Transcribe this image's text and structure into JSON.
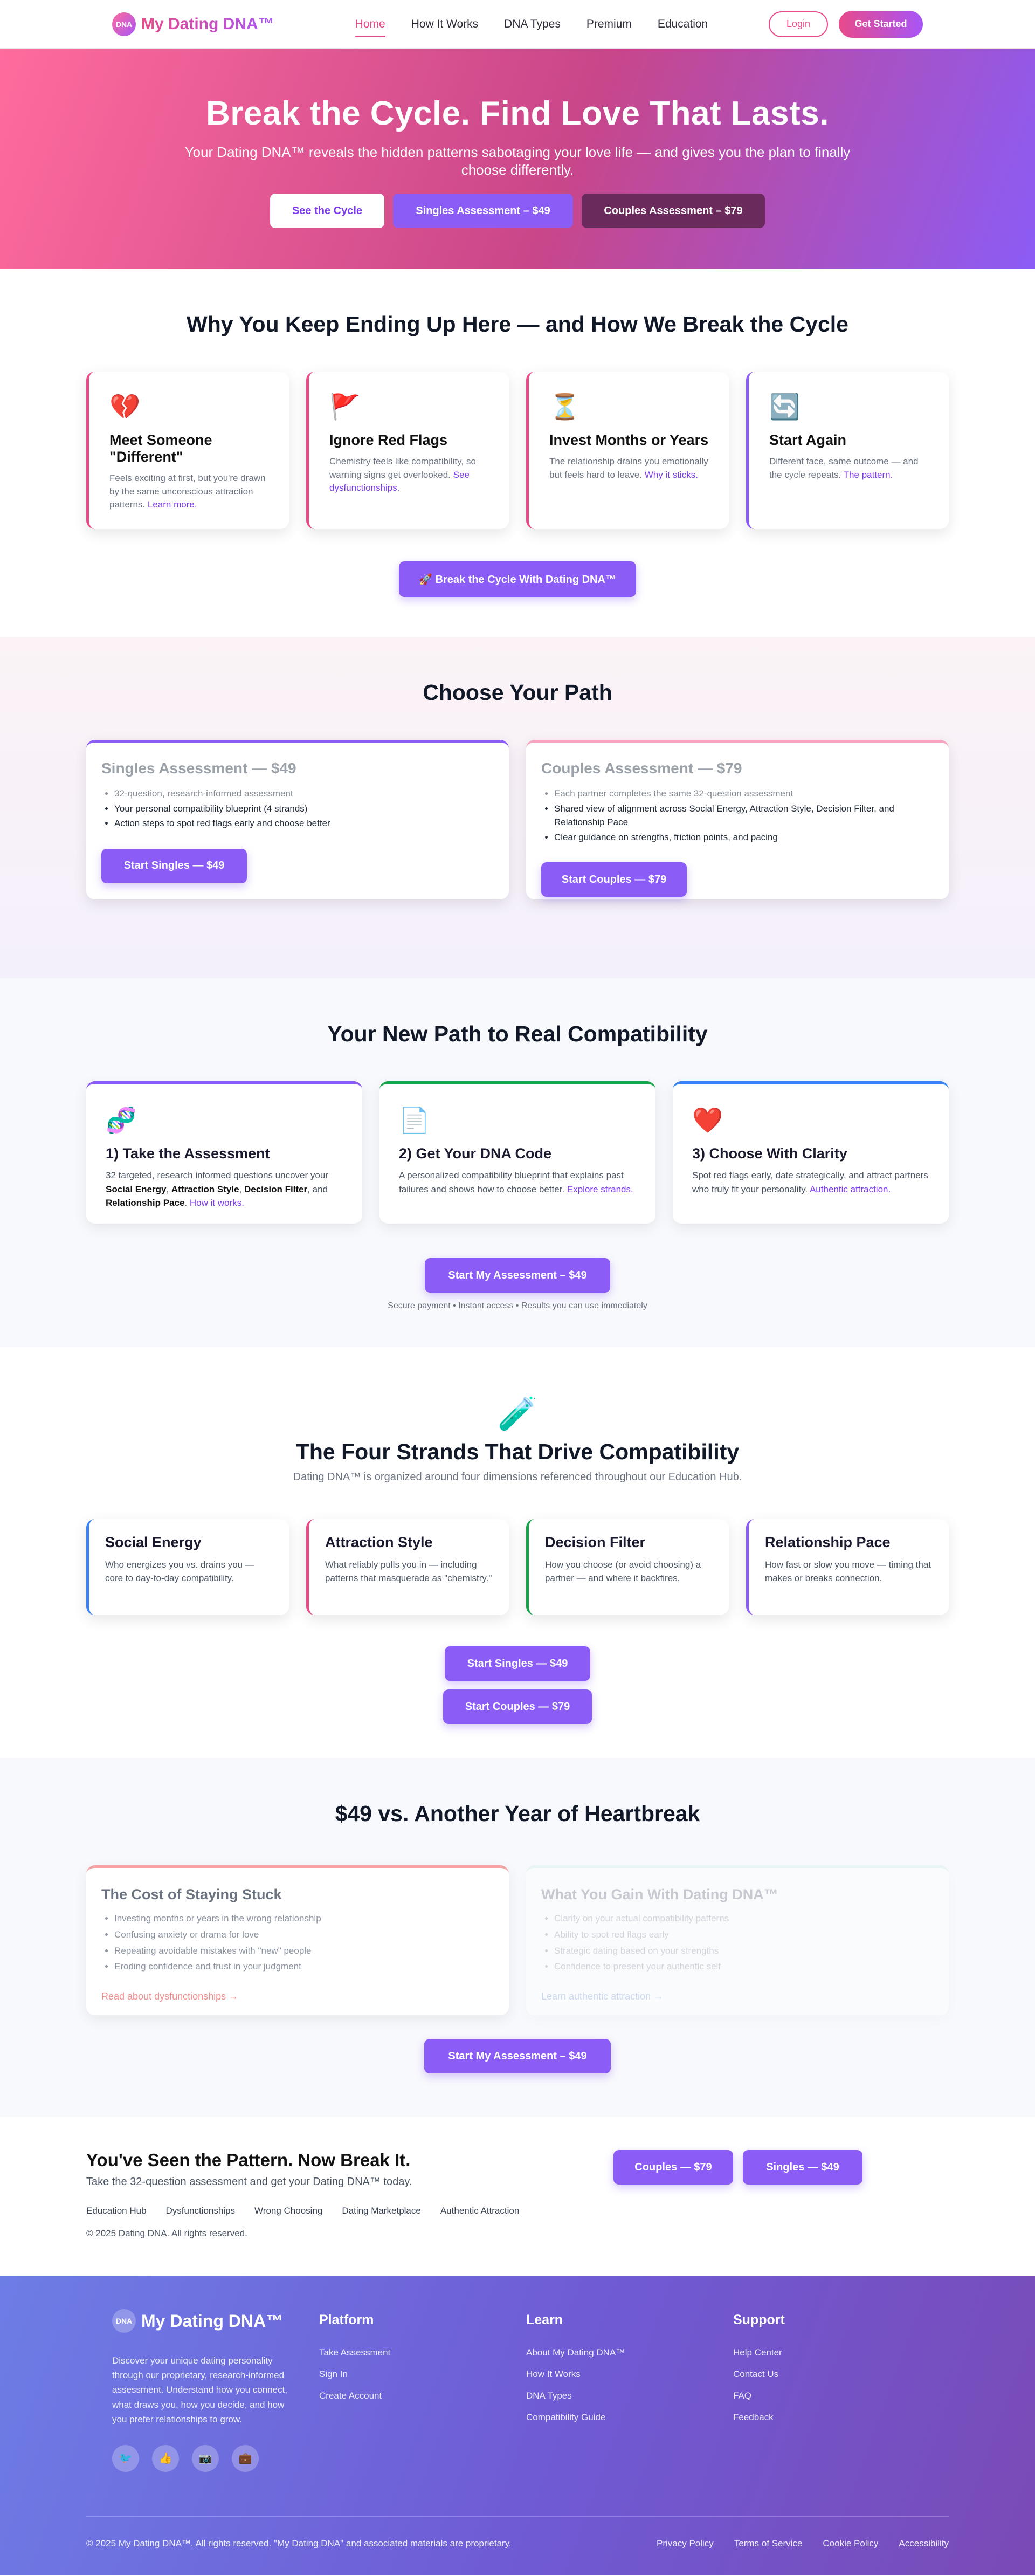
{
  "nav": {
    "badge": "DNA",
    "brand": "My Dating DNA™",
    "links": [
      "Home",
      "How It Works",
      "DNA Types",
      "Premium",
      "Education"
    ],
    "login": "Login",
    "get_started": "Get Started"
  },
  "hero": {
    "title": "Break the Cycle. Find Love That Lasts.",
    "subtitle": "Your Dating DNA™ reveals the hidden patterns sabotaging your love life — and gives you the plan to finally choose differently.",
    "btn_see": "See the Cycle",
    "btn_singles": "Singles Assessment – $49",
    "btn_couples": "Couples Assessment – $79"
  },
  "cycle": {
    "title": "Why You Keep Ending Up Here — and How We Break the Cycle",
    "cards": [
      {
        "icon": "💔",
        "title": "Meet Someone \"Different\"",
        "text": "Feels exciting at first, but you're drawn by the same unconscious attraction patterns.",
        "link": "Learn more."
      },
      {
        "icon": "🚩",
        "title": "Ignore Red Flags",
        "text": "Chemistry feels like compatibility, so warning signs get overlooked.",
        "link": "See dysfunctionships."
      },
      {
        "icon": "⏳",
        "title": "Invest Months or Years",
        "text": "The relationship drains you emotionally but feels hard to leave.",
        "link": "Why it sticks."
      },
      {
        "icon": "🔄",
        "title": "Start Again",
        "text": "Different face, same outcome — and the cycle repeats.",
        "link": "The pattern."
      }
    ],
    "cta": "🚀 Break the Cycle With Dating DNA™"
  },
  "path": {
    "title": "Choose Your Path",
    "singles": {
      "title": "Singles Assessment — $49",
      "items": [
        "32-question, research-informed assessment",
        "Your personal compatibility blueprint (4 strands)",
        "Action steps to spot red flags early and choose better"
      ],
      "btn": "Start Singles — $49"
    },
    "couples": {
      "title": "Couples Assessment — $79",
      "items": [
        "Each partner completes the same 32-question assessment",
        "Shared view of alignment across Social Energy, Attraction Style, Decision Filter, and Relationship Pace",
        "Clear guidance on strengths, friction points, and pacing"
      ],
      "btn": "Start Couples — $79"
    }
  },
  "newpath": {
    "title": "Your New Path to Real Compatibility",
    "cards": [
      {
        "icon": "🧬",
        "title": "1) Take the Assessment",
        "text_a": "32 targeted, research informed questions uncover your ",
        "b1": "Social Energy",
        "sep1": ", ",
        "b2": "Attraction Style",
        "sep2": ", ",
        "b3": "Decision Filter",
        "sep3": ", and ",
        "b4": "Relationship Pace",
        "end": ".",
        "link": "How it works."
      },
      {
        "icon": "📄",
        "title": "2) Get Your DNA Code",
        "text": "A personalized compatibility blueprint that explains past failures and shows how to choose better.",
        "link": "Explore strands."
      },
      {
        "icon": "❤️",
        "title": "3) Choose With Clarity",
        "text": "Spot red flags early, date strategically, and attract partners who truly fit your personality.",
        "link": "Authentic attraction."
      }
    ],
    "cta": "Start My Assessment – $49",
    "note": "Secure payment • Instant access • Results you can use immediately"
  },
  "strands": {
    "icon": "🧪",
    "title": "The Four Strands That Drive Compatibility",
    "subtitle": "Dating DNA™ is organized around four dimensions referenced throughout our Education Hub.",
    "cards": [
      {
        "title": "Social Energy",
        "text": "Who energizes you vs. drains you — core to day-to-day compatibility."
      },
      {
        "title": "Attraction Style",
        "text": "What reliably pulls you in — including patterns that masquerade as \"chemistry.\""
      },
      {
        "title": "Decision Filter",
        "text": "How you choose (or avoid choosing) a partner — and where it backfires."
      },
      {
        "title": "Relationship Pace",
        "text": "How fast or slow you move — timing that makes or breaks connection."
      }
    ],
    "btn_singles": "Start Singles — $49",
    "btn_couples": "Start Couples — $79"
  },
  "cost": {
    "title": "$49 vs. Another Year of Heartbreak",
    "stuck": {
      "title": "The Cost of Staying Stuck",
      "items": [
        "Investing months or years in the wrong relationship",
        "Confusing anxiety or drama for love",
        "Repeating avoidable mistakes with \"new\" people",
        "Eroding confidence and trust in your judgment"
      ],
      "link": "Read about dysfunctionships →"
    },
    "gain": {
      "title": "What You Gain With Dating DNA™",
      "items": [
        "Clarity on your actual compatibility patterns",
        "Ability to spot red flags early",
        "Strategic dating based on your strengths",
        "Confidence to present your authentic self"
      ],
      "link": "Learn authentic attraction →"
    },
    "cta": "Start My Assessment – $49"
  },
  "final": {
    "title": "You've Seen the Pattern. Now Break It.",
    "subtitle": "Take the 32-question assessment and get your Dating DNA™ today.",
    "btn_couples": "Couples — $79",
    "btn_singles": "Singles — $49",
    "links": [
      "Education Hub",
      "Dysfunctionships",
      "Wrong Choosing",
      "Dating Marketplace",
      "Authentic Attraction"
    ],
    "copyright": "© 2025 Dating DNA. All rights reserved."
  },
  "footer": {
    "badge": "DNA",
    "brand": "My Dating DNA™",
    "description": "Discover your unique dating personality through our proprietary, research-informed assessment. Understand how you connect, what draws you, how you decide, and how you prefer relationships to grow.",
    "socials": [
      "🐦",
      "👍",
      "📷",
      "💼"
    ],
    "cols": [
      {
        "title": "Platform",
        "items": [
          "Take Assessment",
          "Sign In",
          "Create Account"
        ]
      },
      {
        "title": "Learn",
        "items": [
          "About My Dating DNA™",
          "How It Works",
          "DNA Types",
          "Compatibility Guide"
        ]
      },
      {
        "title": "Support",
        "items": [
          "Help Center",
          "Contact Us",
          "FAQ",
          "Feedback"
        ]
      }
    ],
    "copyright": "© 2025 My Dating DNA™. All rights reserved. \"My Dating DNA\" and associated materials are proprietary.",
    "legal": [
      "Privacy Policy",
      "Terms of Service",
      "Cookie Policy",
      "Accessibility"
    ]
  }
}
